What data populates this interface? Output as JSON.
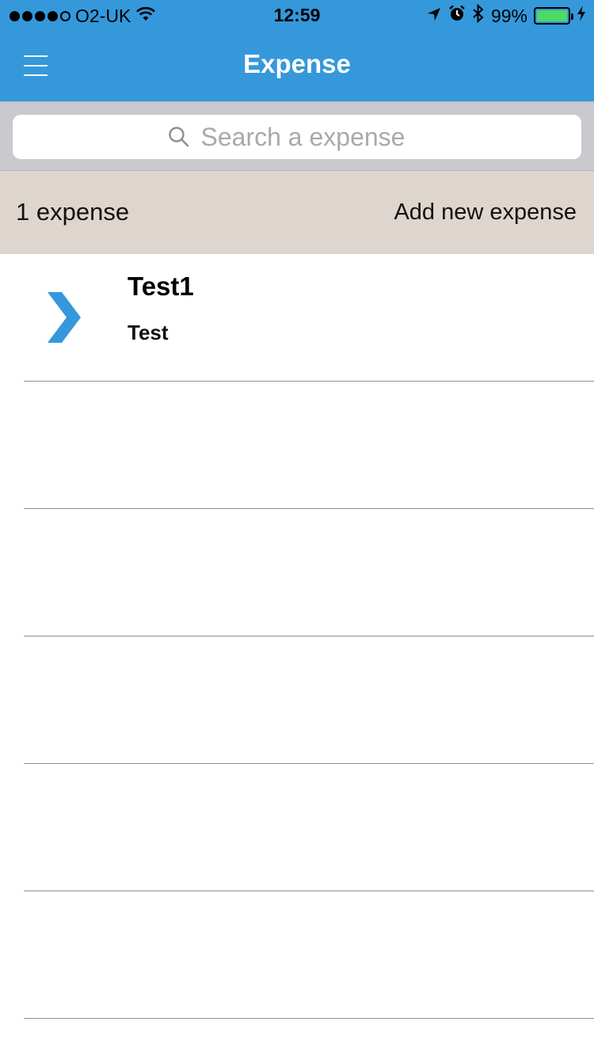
{
  "status_bar": {
    "carrier": "O2-UK",
    "signal_filled": 4,
    "signal_total": 5,
    "time": "12:59",
    "battery_percent_text": "99%",
    "battery_level": 0.99,
    "icons": [
      "wifi-icon",
      "location-arrow-icon",
      "alarm-icon",
      "bluetooth-icon",
      "battery-icon",
      "charging-bolt-icon"
    ]
  },
  "navbar": {
    "title": "Expense",
    "menu_icon": "hamburger-menu-icon",
    "background": "#3498db"
  },
  "search": {
    "placeholder": "Search a expense",
    "value": "",
    "icon": "search-icon"
  },
  "header": {
    "count_label": "1 expense",
    "add_label": "Add new expense",
    "background": "#ded6ce"
  },
  "expenses": [
    {
      "title": "Test1",
      "subtitle": "Test",
      "icon": "chevron-right-icon",
      "icon_color": "#3498db"
    }
  ],
  "empty_row_count": 5
}
